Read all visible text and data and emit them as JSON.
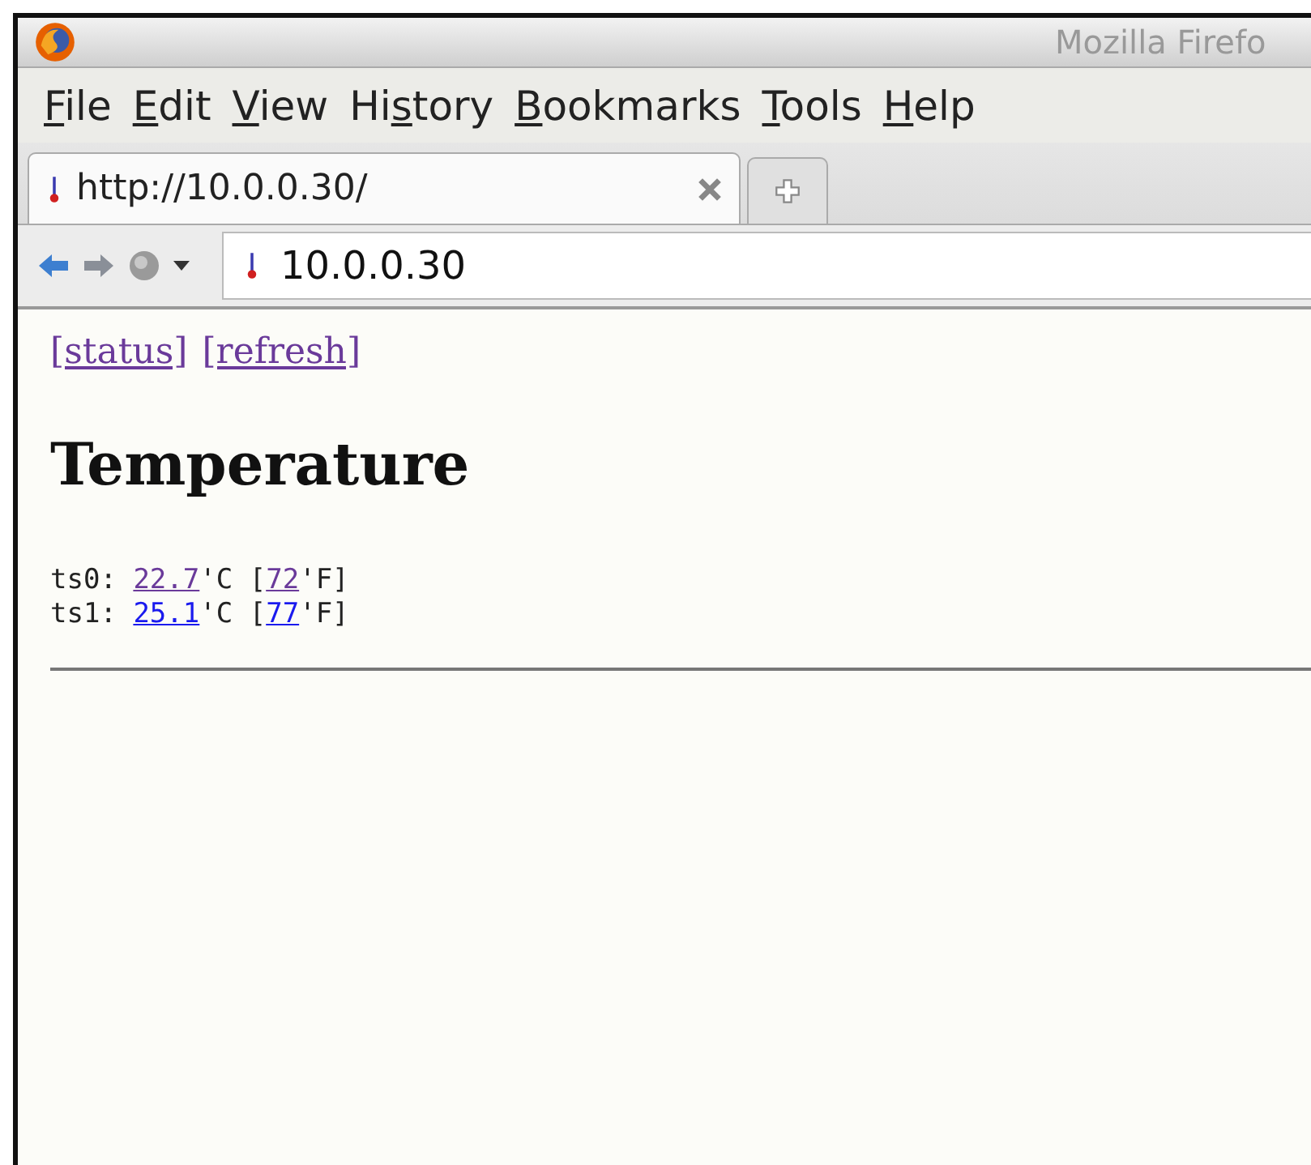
{
  "window": {
    "title": "Mozilla Firefo"
  },
  "menu": [
    {
      "key": "F",
      "rest": "ile"
    },
    {
      "key": "E",
      "rest": "dit"
    },
    {
      "key": "V",
      "rest": "iew"
    },
    {
      "before": "Hi",
      "key": "s",
      "rest": "tory"
    },
    {
      "key": "B",
      "rest": "ookmarks"
    },
    {
      "key": "T",
      "rest": "ools"
    },
    {
      "key": "H",
      "rest": "elp"
    }
  ],
  "tabs": [
    {
      "label": "http://10.0.0.30/",
      "selected": true
    }
  ],
  "address": {
    "value": "10.0.0.30"
  },
  "page": {
    "links": [
      {
        "label": "[status]",
        "visited": true
      },
      {
        "label": "[refresh]",
        "visited": true
      }
    ],
    "heading": "Temperature",
    "readings": [
      {
        "name": "ts0:",
        "celsius": "22.7",
        "celsius_visited": true,
        "c_unit": "'C [",
        "fahrenheit": "72",
        "fahrenheit_visited": true,
        "f_unit": "'F]"
      },
      {
        "name": "ts1:",
        "celsius": "25.1",
        "celsius_visited": false,
        "c_unit": "'C [",
        "fahrenheit": "77",
        "fahrenheit_visited": false,
        "f_unit": "'F]"
      }
    ]
  }
}
